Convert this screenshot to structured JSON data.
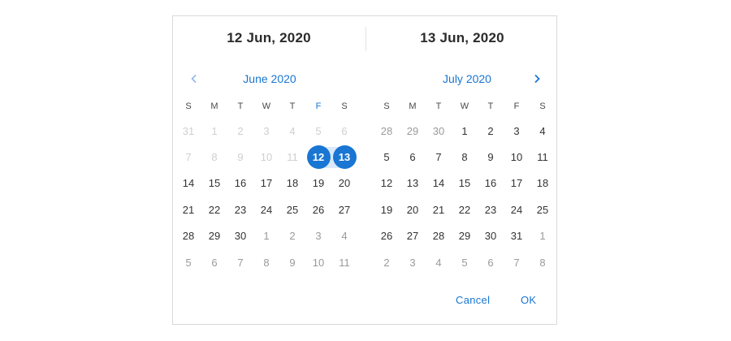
{
  "header": {
    "start_date": "12 Jun, 2020",
    "end_date": "13 Jun, 2020"
  },
  "left_month": {
    "title": "June 2020",
    "weekdays": [
      "S",
      "M",
      "T",
      "W",
      "T",
      "F",
      "S"
    ],
    "weeks": [
      [
        {
          "d": "31",
          "s": "disabled"
        },
        {
          "d": "1",
          "s": "disabled"
        },
        {
          "d": "2",
          "s": "disabled"
        },
        {
          "d": "3",
          "s": "disabled"
        },
        {
          "d": "4",
          "s": "disabled"
        },
        {
          "d": "5",
          "s": "disabled"
        },
        {
          "d": "6",
          "s": "disabled"
        }
      ],
      [
        {
          "d": "7",
          "s": "disabled"
        },
        {
          "d": "8",
          "s": "disabled"
        },
        {
          "d": "9",
          "s": "disabled"
        },
        {
          "d": "10",
          "s": "disabled"
        },
        {
          "d": "11",
          "s": "disabled"
        },
        {
          "d": "12",
          "s": "selected-start"
        },
        {
          "d": "13",
          "s": "selected-end"
        }
      ],
      [
        {
          "d": "14",
          "s": "normal"
        },
        {
          "d": "15",
          "s": "normal"
        },
        {
          "d": "16",
          "s": "normal"
        },
        {
          "d": "17",
          "s": "normal"
        },
        {
          "d": "18",
          "s": "normal"
        },
        {
          "d": "19",
          "s": "normal"
        },
        {
          "d": "20",
          "s": "normal"
        }
      ],
      [
        {
          "d": "21",
          "s": "normal"
        },
        {
          "d": "22",
          "s": "normal"
        },
        {
          "d": "23",
          "s": "normal"
        },
        {
          "d": "24",
          "s": "normal"
        },
        {
          "d": "25",
          "s": "normal"
        },
        {
          "d": "26",
          "s": "normal"
        },
        {
          "d": "27",
          "s": "normal"
        }
      ],
      [
        {
          "d": "28",
          "s": "normal"
        },
        {
          "d": "29",
          "s": "normal"
        },
        {
          "d": "30",
          "s": "normal"
        },
        {
          "d": "1",
          "s": "muted"
        },
        {
          "d": "2",
          "s": "muted"
        },
        {
          "d": "3",
          "s": "muted"
        },
        {
          "d": "4",
          "s": "muted"
        }
      ],
      [
        {
          "d": "5",
          "s": "muted"
        },
        {
          "d": "6",
          "s": "muted"
        },
        {
          "d": "7",
          "s": "muted"
        },
        {
          "d": "8",
          "s": "muted"
        },
        {
          "d": "9",
          "s": "muted"
        },
        {
          "d": "10",
          "s": "muted"
        },
        {
          "d": "11",
          "s": "muted"
        }
      ]
    ]
  },
  "right_month": {
    "title": "July 2020",
    "weekdays": [
      "S",
      "M",
      "T",
      "W",
      "T",
      "F",
      "S"
    ],
    "weeks": [
      [
        {
          "d": "28",
          "s": "muted"
        },
        {
          "d": "29",
          "s": "muted"
        },
        {
          "d": "30",
          "s": "muted"
        },
        {
          "d": "1",
          "s": "normal"
        },
        {
          "d": "2",
          "s": "normal"
        },
        {
          "d": "3",
          "s": "normal"
        },
        {
          "d": "4",
          "s": "normal"
        }
      ],
      [
        {
          "d": "5",
          "s": "normal"
        },
        {
          "d": "6",
          "s": "normal"
        },
        {
          "d": "7",
          "s": "normal"
        },
        {
          "d": "8",
          "s": "normal"
        },
        {
          "d": "9",
          "s": "normal"
        },
        {
          "d": "10",
          "s": "normal"
        },
        {
          "d": "11",
          "s": "normal"
        }
      ],
      [
        {
          "d": "12",
          "s": "normal"
        },
        {
          "d": "13",
          "s": "normal"
        },
        {
          "d": "14",
          "s": "normal"
        },
        {
          "d": "15",
          "s": "normal"
        },
        {
          "d": "16",
          "s": "normal"
        },
        {
          "d": "17",
          "s": "normal"
        },
        {
          "d": "18",
          "s": "normal"
        }
      ],
      [
        {
          "d": "19",
          "s": "normal"
        },
        {
          "d": "20",
          "s": "normal"
        },
        {
          "d": "21",
          "s": "normal"
        },
        {
          "d": "22",
          "s": "normal"
        },
        {
          "d": "23",
          "s": "normal"
        },
        {
          "d": "24",
          "s": "normal"
        },
        {
          "d": "25",
          "s": "normal"
        }
      ],
      [
        {
          "d": "26",
          "s": "normal"
        },
        {
          "d": "27",
          "s": "normal"
        },
        {
          "d": "28",
          "s": "normal"
        },
        {
          "d": "29",
          "s": "normal"
        },
        {
          "d": "30",
          "s": "normal"
        },
        {
          "d": "31",
          "s": "normal"
        },
        {
          "d": "1",
          "s": "muted"
        }
      ],
      [
        {
          "d": "2",
          "s": "muted"
        },
        {
          "d": "3",
          "s": "muted"
        },
        {
          "d": "4",
          "s": "muted"
        },
        {
          "d": "5",
          "s": "muted"
        },
        {
          "d": "6",
          "s": "muted"
        },
        {
          "d": "7",
          "s": "muted"
        },
        {
          "d": "8",
          "s": "muted"
        }
      ]
    ]
  },
  "nav": {
    "prev_icon": "chevron-left-icon",
    "next_icon": "chevron-right-icon"
  },
  "footer": {
    "cancel_label": "Cancel",
    "ok_label": "OK"
  },
  "colors": {
    "accent": "#1976d2",
    "range_fill": "#dbe9fa",
    "disabled": "#cfcfcf",
    "muted": "#9a9a9a"
  }
}
